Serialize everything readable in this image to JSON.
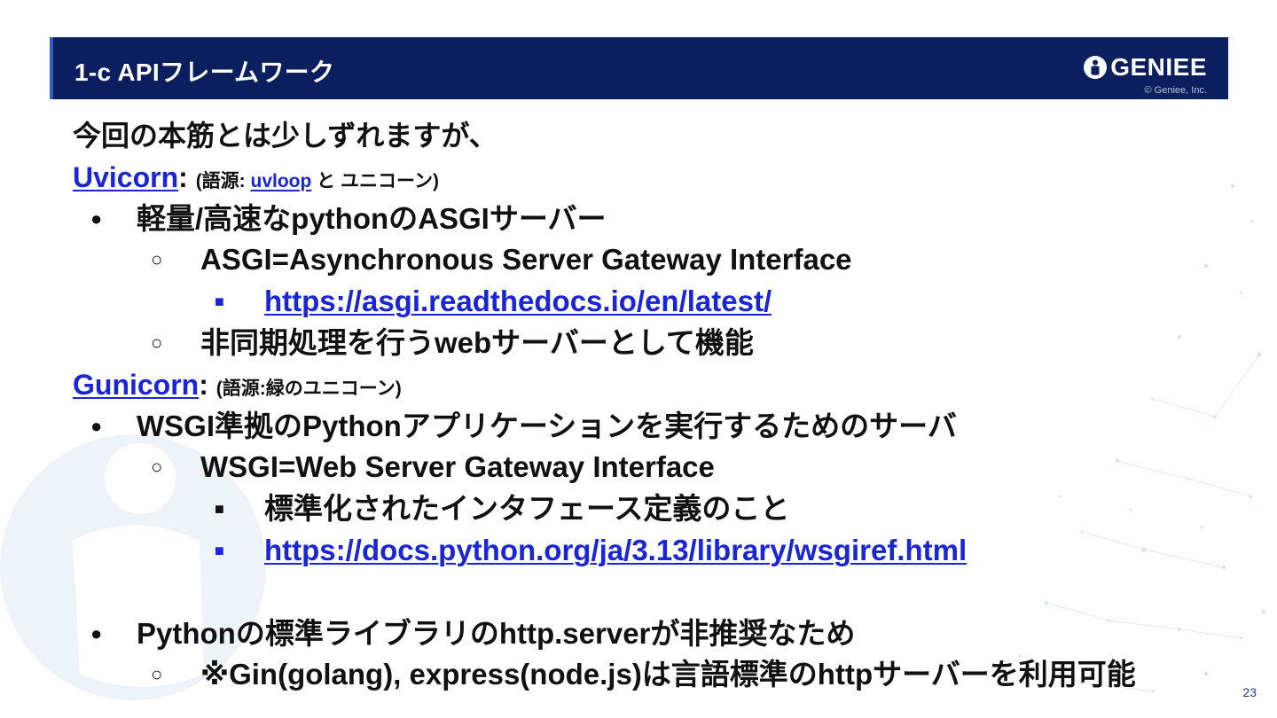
{
  "header": {
    "title": "1-c APIフレームワーク",
    "logo_text": "GENIEE",
    "copyright": "© Geniee, Inc."
  },
  "intro": "今回の本筋とは少しずれますが、",
  "uvicorn": {
    "name": "Uvicorn",
    "colon": ":",
    "etym_open": "(語源: ",
    "etym_link": "uvloop",
    "etym_rest": " と ユニコーン)",
    "bullet1": "軽量/高速なpythonのASGIサーバー",
    "sub1": "ASGI=Asynchronous Server Gateway Interface",
    "sub1_link": "https://asgi.readthedocs.io/en/latest/",
    "sub2": "非同期処理を行うwebサーバーとして機能"
  },
  "gunicorn": {
    "name": "Gunicorn",
    "colon": ":",
    "etym": "(語源:緑のユニコーン)",
    "bullet1": "WSGI準拠のPythonアプリケーションを実行するためのサーバ",
    "sub1": "WSGI=Web Server Gateway Interface",
    "sub1_item1": "標準化されたインタフェース定義のこと",
    "sub1_link": "https://docs.python.org/ja/3.13/library/wsgiref.html",
    "bullet2": "Pythonの標準ライブラリのhttp.serverが非推奨なため",
    "sub2": "※Gin(golang), express(node.js)は言語標準のhttpサーバーを利用可能"
  },
  "bullets": {
    "level1": "●",
    "level2": "○",
    "level3": "■"
  },
  "page_number": "23",
  "colors": {
    "header_bg": "#0b1f5e",
    "link": "#1a25d6",
    "text": "#111111"
  }
}
